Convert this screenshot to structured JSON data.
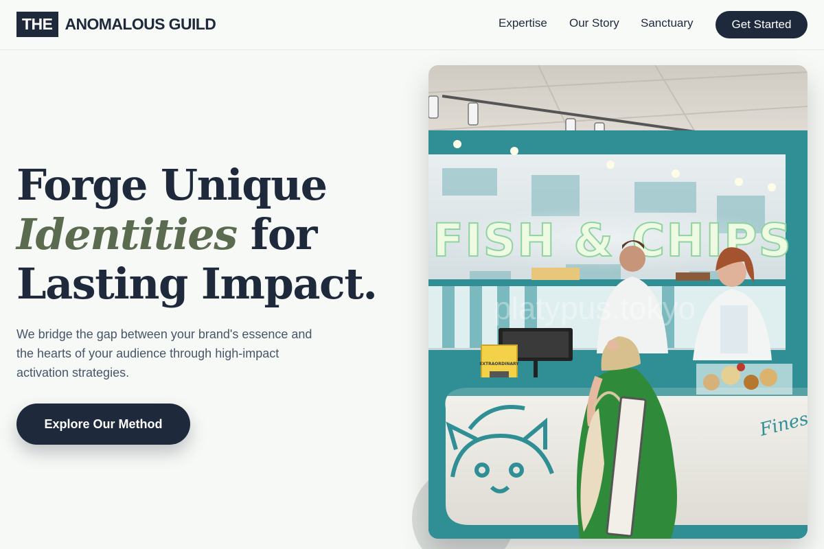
{
  "brand": {
    "prefix": "THE",
    "name": "ANOMALOUS GUILD"
  },
  "nav": {
    "items": [
      "Expertise",
      "Our Story",
      "Sanctuary"
    ],
    "cta": "Get Started"
  },
  "hero": {
    "line1": "Forge Unique",
    "line2_em": "Identities",
    "line2_rest": " for",
    "line3": "Lasting Impact.",
    "subtitle": "We bridge the gap between your brand's essence and the hearts of your audience through high-impact activation strategies.",
    "button": "Explore Our Method"
  },
  "image": {
    "sign_text": "FISH & CHIPS",
    "counter_script": "Finest",
    "placard_text": "EXTRAORDINARY",
    "watermark": "platypus.tokyo"
  },
  "colors": {
    "navy": "#1e293b",
    "olive": "#5b6b4f",
    "teal": "#2f8f94",
    "background": "#f7f9f6"
  }
}
